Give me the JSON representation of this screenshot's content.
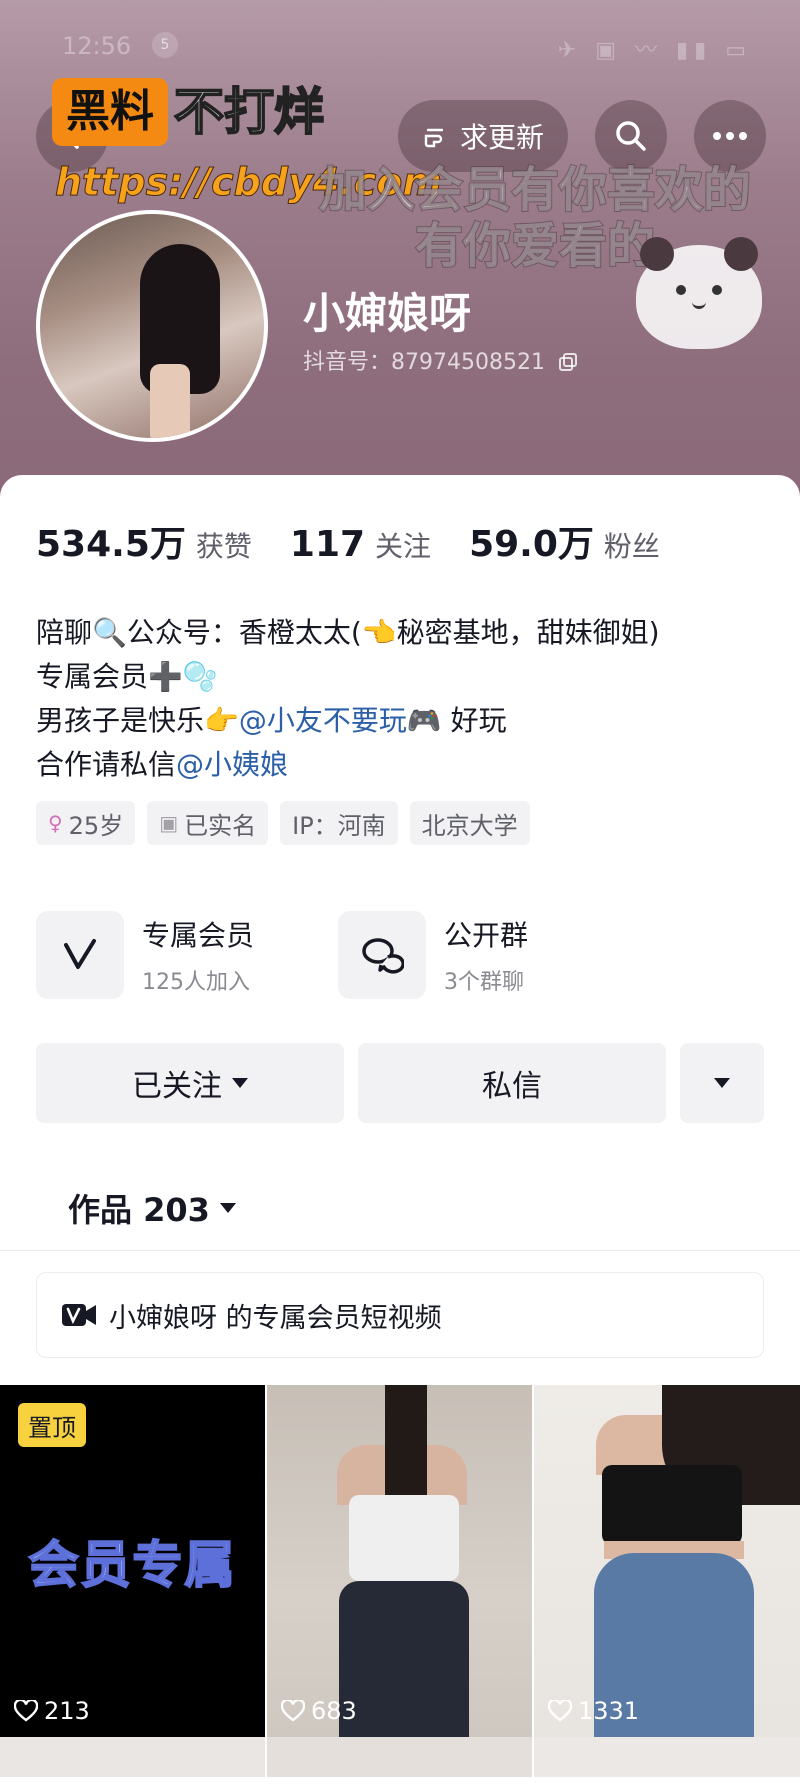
{
  "status": {
    "time": "12:56",
    "badge": "5",
    "icons": "✈ ▣ 〰 ▮▮ ▭"
  },
  "watermark": {
    "box_label": "黑料",
    "text": "不打烊",
    "url": "https://cbdy4.com"
  },
  "header": {
    "request_update_label": "求更新",
    "caption_lines": [
      "加入会员有你喜欢的",
      "有你爱看的"
    ]
  },
  "profile": {
    "nickname": "小婶娘呀",
    "douyin_id": "抖音号：87974508521",
    "stats": [
      {
        "num": "534.5万",
        "label": "获赞"
      },
      {
        "num": "117",
        "label": "关注"
      },
      {
        "num": "59.0万",
        "label": "粉丝"
      }
    ],
    "bio": {
      "line1": "陪聊🔍公众号：香橙太太(👈秘密基地，甜妹御姐)",
      "line2": "专属会员➕🫧",
      "line3_pre": "男孩子是快乐👉",
      "line3_mention": "@小友不要玩",
      "line3_post": "🎮 好玩",
      "line4_pre": "合作请私信",
      "line4_mention": "@小姨娘"
    },
    "tags": [
      {
        "icon": "female-icon",
        "glyph": "♀",
        "label": "25岁"
      },
      {
        "icon": "id-card-icon",
        "glyph": "▣",
        "label": "已实名"
      },
      {
        "icon": "",
        "glyph": "",
        "label": "IP：河南"
      },
      {
        "icon": "",
        "glyph": "",
        "label": "北京大学"
      }
    ]
  },
  "features": [
    {
      "title": "专属会员",
      "sub": "125人加入"
    },
    {
      "title": "公开群",
      "sub": "3个群聊"
    }
  ],
  "actions": {
    "follow_label": "已关注",
    "message_label": "私信"
  },
  "tabs": {
    "works_label": "作品 203"
  },
  "member_strip": {
    "label": "小婶娘呀 的专属会员短视频"
  },
  "grid": [
    {
      "pin": "置顶",
      "overlay": "会员专属",
      "likes": "213"
    },
    {
      "pin": "",
      "overlay": "",
      "likes": "683"
    },
    {
      "pin": "",
      "overlay": "",
      "likes": "1331"
    }
  ]
}
